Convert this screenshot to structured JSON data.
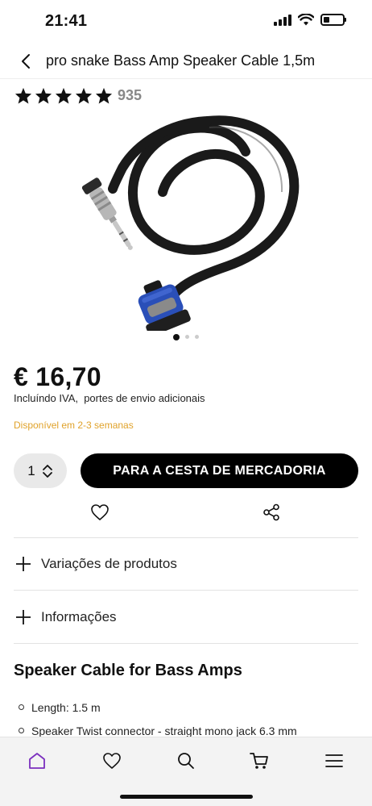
{
  "status": {
    "time": "21:41",
    "battery_level": 0.3
  },
  "header": {
    "title": "pro snake Bass Amp Speaker Cable 1,5m",
    "back_icon": "chevron-left-icon"
  },
  "rating": {
    "stars": 5,
    "count": "935"
  },
  "carousel": {
    "pages": 3,
    "active": 1
  },
  "price": {
    "amount": "€ 16,70",
    "note": "Incluíndo IVA,  portes de envio adicionais"
  },
  "availability": "Disponível em 2-3 semanas",
  "purchase": {
    "quantity": "1",
    "add_to_cart_label": "PARA A CESTA DE MERCADORIA"
  },
  "accordions": [
    {
      "label": "Variações de produtos"
    },
    {
      "label": "Informações"
    }
  ],
  "description": {
    "heading": "Speaker Cable for Bass Amps",
    "specs": [
      "Length: 1.5 m",
      "Speaker Twist connector - straight mono jack 6.3 mm"
    ]
  },
  "tabbar": {
    "items": [
      "home-icon",
      "heart-icon",
      "search-icon",
      "cart-icon",
      "menu-icon"
    ],
    "active": "home-icon",
    "active_color": "#7b2fbe"
  },
  "colors": {
    "availability": "#e0a22a",
    "button": "#000000",
    "connector_blue": "#2a4fb8"
  }
}
